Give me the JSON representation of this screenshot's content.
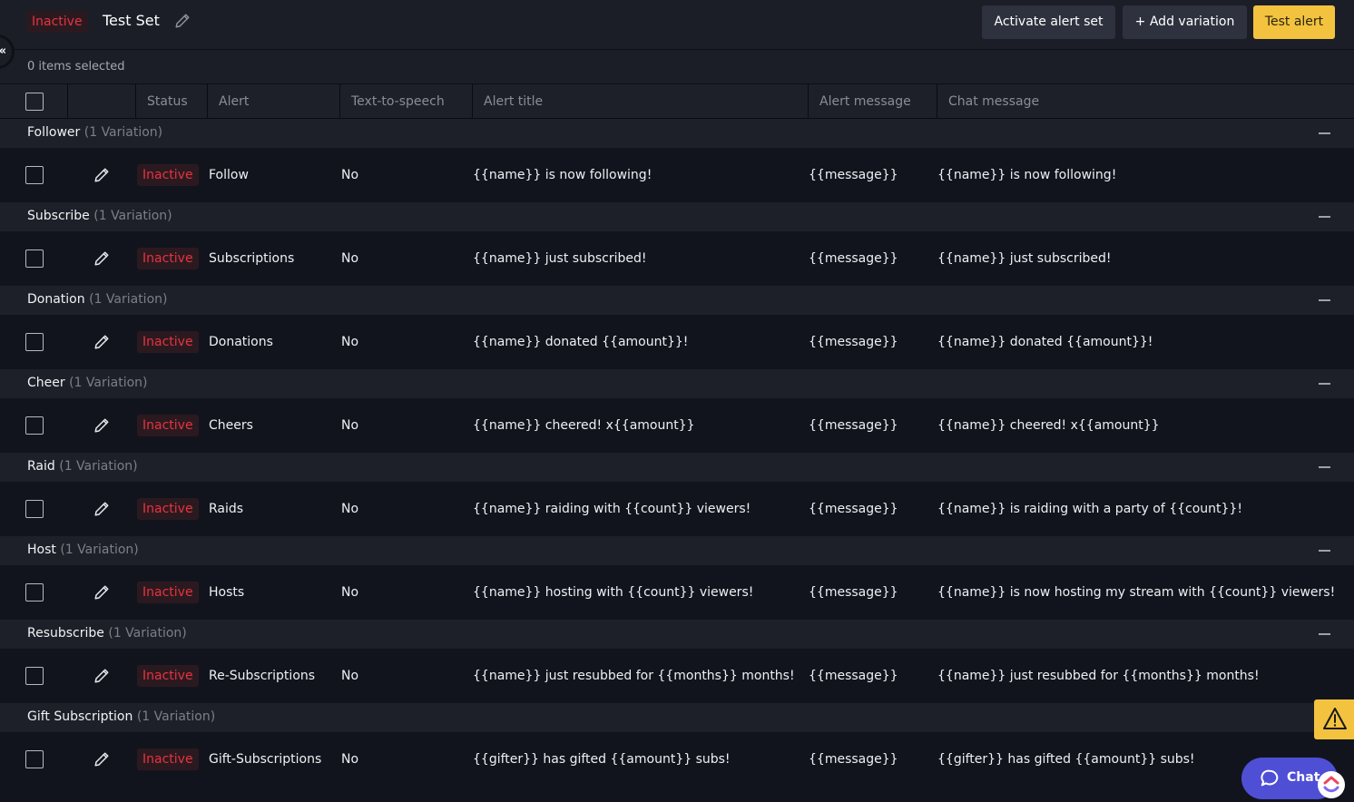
{
  "header": {
    "status_badge": "Inactive",
    "title": "Test Set",
    "buttons": {
      "activate": "Activate alert set",
      "add_variation": "+ Add variation",
      "test_alert": "Test alert"
    }
  },
  "selection": {
    "text": "0 items selected"
  },
  "table": {
    "columns": [
      "",
      "",
      "Status",
      "Alert",
      "Text-to-speech",
      "Alert title",
      "Alert message",
      "Chat message"
    ],
    "groups": [
      {
        "name": "Follower",
        "count": "(1 Variation)",
        "rows": [
          {
            "status": "Inactive",
            "alert": "Follow",
            "tts": "No",
            "alert_title": "{{name}} is now following!",
            "alert_message": "{{message}}",
            "chat_message": "{{name}} is now following!"
          }
        ]
      },
      {
        "name": "Subscribe",
        "count": "(1 Variation)",
        "rows": [
          {
            "status": "Inactive",
            "alert": "Subscriptions",
            "tts": "No",
            "alert_title": "{{name}} just subscribed!",
            "alert_message": "{{message}}",
            "chat_message": "{{name}} just subscribed!"
          }
        ]
      },
      {
        "name": "Donation",
        "count": "(1 Variation)",
        "rows": [
          {
            "status": "Inactive",
            "alert": "Donations",
            "tts": "No",
            "alert_title": "{{name}} donated {{amount}}!",
            "alert_message": "{{message}}",
            "chat_message": "{{name}} donated {{amount}}!"
          }
        ]
      },
      {
        "name": "Cheer",
        "count": "(1 Variation)",
        "rows": [
          {
            "status": "Inactive",
            "alert": "Cheers",
            "tts": "No",
            "alert_title": "{{name}} cheered! x{{amount}}",
            "alert_message": "{{message}}",
            "chat_message": "{{name}} cheered! x{{amount}}"
          }
        ]
      },
      {
        "name": "Raid",
        "count": "(1 Variation)",
        "rows": [
          {
            "status": "Inactive",
            "alert": "Raids",
            "tts": "No",
            "alert_title": "{{name}} raiding with {{count}} viewers!",
            "alert_message": "{{message}}",
            "chat_message": "{{name}} is raiding with a party of {{count}}!"
          }
        ]
      },
      {
        "name": "Host",
        "count": "(1 Variation)",
        "rows": [
          {
            "status": "Inactive",
            "alert": "Hosts",
            "tts": "No",
            "alert_title": "{{name}} hosting with {{count}} viewers!",
            "alert_message": "{{message}}",
            "chat_message": "{{name}} is now hosting my stream with {{count}} viewers!"
          }
        ]
      },
      {
        "name": "Resubscribe",
        "count": "(1 Variation)",
        "rows": [
          {
            "status": "Inactive",
            "alert": "Re-Subscriptions",
            "tts": "No",
            "alert_title": "{{name}} just resubbed for {{months}} months!",
            "alert_message": "{{message}}",
            "chat_message": "{{name}} just resubbed for {{months}} months!"
          }
        ]
      },
      {
        "name": "Gift Subscription",
        "count": "(1 Variation)",
        "rows": [
          {
            "status": "Inactive",
            "alert": "Gift-Subscriptions",
            "tts": "No",
            "alert_title": "{{gifter}} has gifted {{amount}} subs!",
            "alert_message": "{{message}}",
            "chat_message": "{{gifter}} has gifted {{amount}} subs!"
          }
        ]
      }
    ]
  },
  "widgets": {
    "chat_label": "Chat",
    "icons": {
      "warning": "warning-triangle-icon",
      "chat": "chat-bubble-icon",
      "edit": "pencil-icon",
      "collapse": "collapse-sidebar-icon",
      "logo": "clickup-logo-icon"
    }
  },
  "colors": {
    "inactive": "#e8323f",
    "accent_yellow": "#f3c33f",
    "chat_blue": "#4f4fd6"
  }
}
